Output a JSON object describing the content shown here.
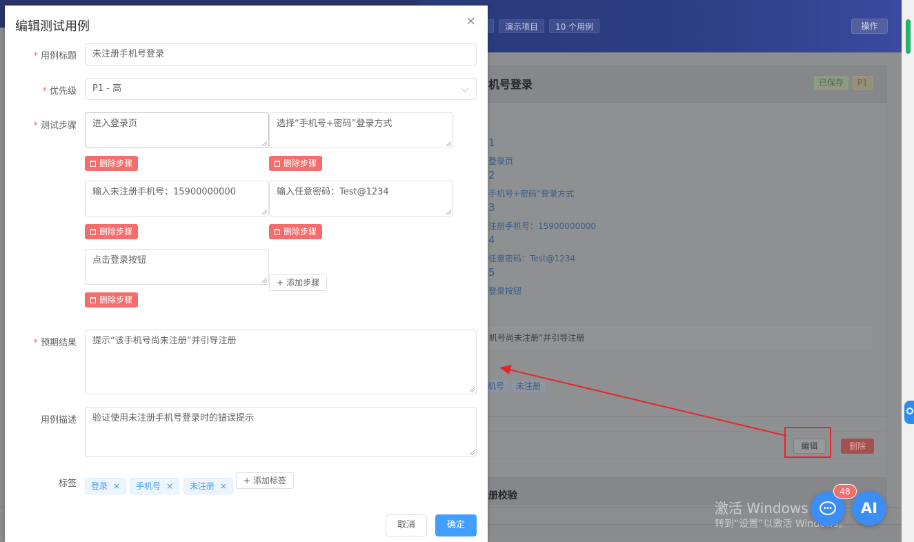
{
  "background": {
    "header_chips": [
      "演示项目",
      "10 个用例"
    ],
    "header_op": "操作",
    "case_title": "机号登录",
    "saved_tag": "已保存",
    "priority_tag": "P1",
    "step_numbers": [
      "1",
      "2",
      "3",
      "4",
      "5"
    ],
    "step_lines": [
      "登录页",
      "手机号+密码”登录方式",
      "注册手机号：15900000000",
      "任意密码：Test@1234",
      "登录按钮"
    ],
    "expected_box": "机号尚未注册”并引导注册",
    "tag_chips": [
      "机号",
      "未注册"
    ],
    "edit_button": "编辑",
    "delete_button": "删除",
    "second_card_title": "册校验",
    "watermark_line1": "激活 Windows",
    "watermark_line2": "转到“设置”以激活 Windows。"
  },
  "floating": {
    "chat_badge": "48",
    "ai_label": "AI"
  },
  "dialog": {
    "title": "编辑测试用例",
    "close_symbol": "×",
    "fields": {
      "title_label": "用例标题",
      "title_value": "未注册手机号登录",
      "priority_label": "优先级",
      "priority_value": "P1 - 高",
      "steps_label": "测试步骤",
      "expected_label": "预期结果",
      "expected_value": "提示“该手机号尚未注册”并引导注册",
      "description_label": "用例描述",
      "description_value": "验证使用未注册手机号登录时的错误提示",
      "tags_label": "标签"
    },
    "steps": [
      "进入登录页",
      "选择“手机号+密码”登录方式",
      "输入未注册手机号：15900000000",
      "输入任意密码：Test@1234",
      "点击登录按钮"
    ],
    "delete_step_label": "删除步骤",
    "add_step_label": "添加步骤",
    "tags": [
      "登录",
      "手机号",
      "未注册"
    ],
    "add_tag_label": "+ 添加标签",
    "cancel_label": "取消",
    "confirm_label": "确定"
  }
}
